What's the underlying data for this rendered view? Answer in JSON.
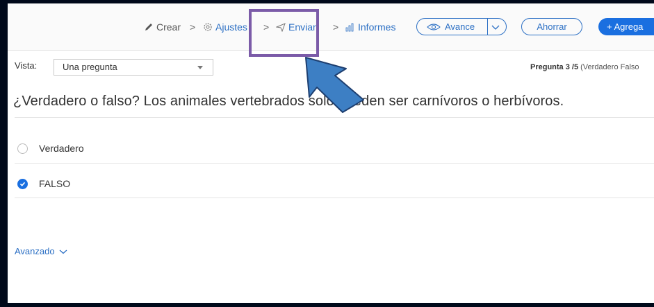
{
  "breadcrumb": {
    "crear": "Crear",
    "ajustes": "Ajustes",
    "enviar": "Enviar",
    "informes": "Informes",
    "separator": ">"
  },
  "toolbar": {
    "avance_label": "Avance",
    "ahorrar_label": "Ahorrar",
    "agregar_label": "+ Agrega"
  },
  "view": {
    "label": "Vista:",
    "selected": "Una pregunta"
  },
  "question_info": {
    "counter": "Pregunta 3 /5",
    "type": "(Verdadero Falso"
  },
  "question": {
    "text": "¿Verdadero o falso? Los animales vertebrados solo pueden ser carnívoros o herbívoros.",
    "options": [
      {
        "label": "Verdadero",
        "checked": false
      },
      {
        "label": "FALSO",
        "checked": true
      }
    ]
  },
  "advanced_label": "Avanzado",
  "colors": {
    "accent": "#1a6fe0",
    "highlight_box": "#7b5ba8",
    "pointer_arrow": "#3d7fc4"
  },
  "icons": [
    "pencil-icon",
    "gear-icon",
    "paper-plane-icon",
    "bar-chart-icon",
    "eye-icon",
    "chevron-down-icon",
    "check-icon"
  ]
}
